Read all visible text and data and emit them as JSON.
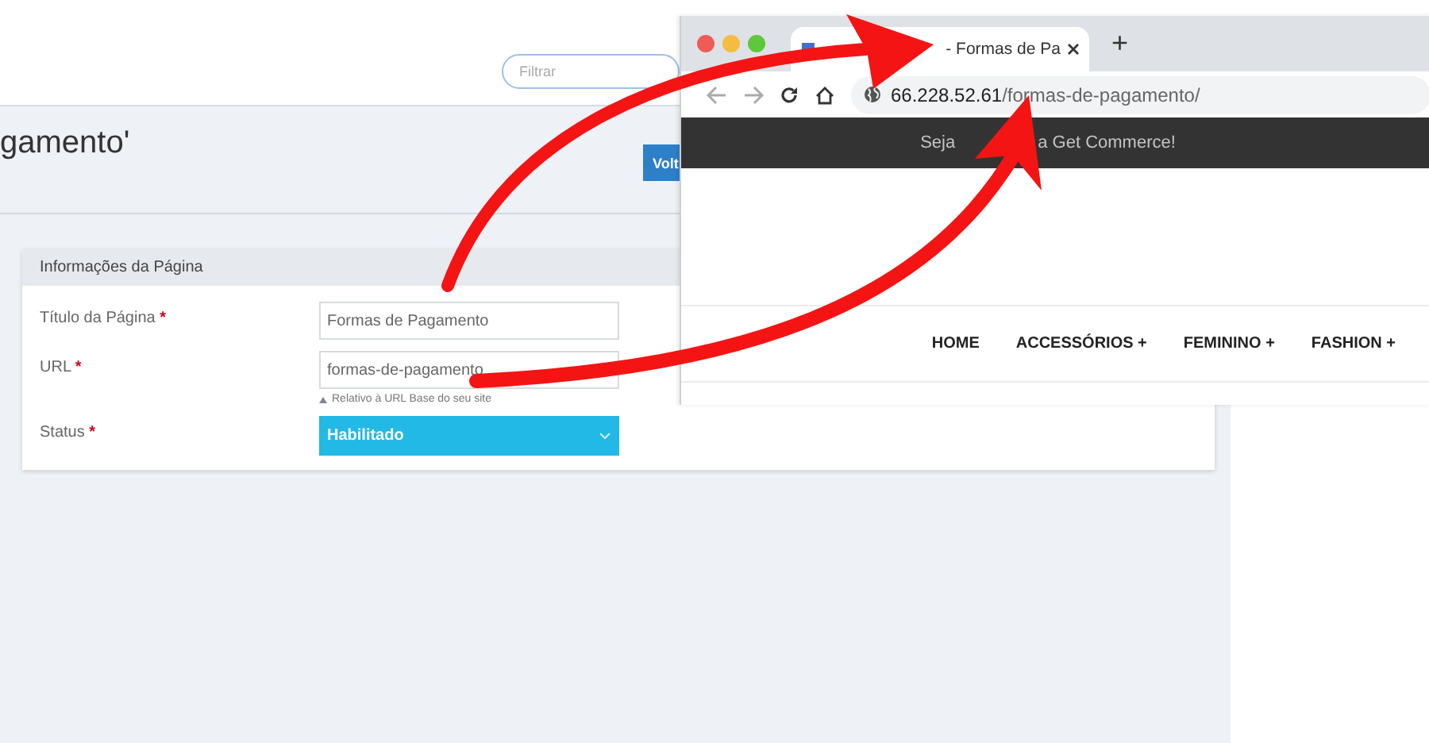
{
  "admin": {
    "filter": {
      "placeholder": "Filtrar"
    },
    "page_title": "gamento'",
    "back_button": "Volt",
    "section": {
      "title": "Informações da Página",
      "fields": [
        {
          "kind": "text",
          "label": "Título da Página",
          "required_mark": "*",
          "value": "Formas de Pagamento"
        },
        {
          "kind": "text",
          "label": "URL",
          "required_mark": "*",
          "value": "formas-de-pagamento",
          "hint": "Relativo à URL Base do seu site"
        },
        {
          "kind": "select",
          "label": "Status",
          "required_mark": "*",
          "value": "Habilitado"
        }
      ]
    }
  },
  "browser": {
    "tab": {
      "title": "- Formas de Pa",
      "selected": true
    },
    "new_tab": "+",
    "address": {
      "host": "66.228.52.61",
      "path": "/formas-de-pagamento/"
    },
    "banner": [
      "Seja",
      "a Get Commerce!"
    ],
    "menu": [
      {
        "label": "HOME"
      },
      {
        "label": "ACCESSÓRIOS +"
      },
      {
        "label": "FEMININO +"
      },
      {
        "label": "FASHION +"
      }
    ]
  }
}
